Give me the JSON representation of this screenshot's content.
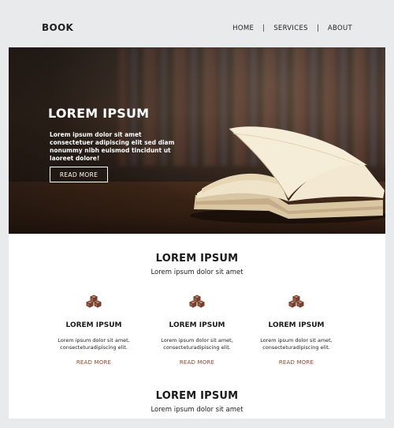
{
  "header": {
    "logo": "BOOK",
    "nav": [
      "HOME",
      "SERVICES",
      "ABOUT"
    ],
    "separator": "|"
  },
  "hero": {
    "title": "LOREM IPSUM",
    "text": "Lorem ipsum dolor sit amet consectetuer adipiscing elit sed diam nonummy nibh euismod tincidunt ut laoreet dolore!",
    "button": "READ MORE"
  },
  "section1": {
    "title": "LOREM IPSUM",
    "subtitle": "Lorem ipsum dolor sit amet"
  },
  "features": [
    {
      "icon": "boxes-icon",
      "title": "LOREM IPSUM",
      "text": "Lorem ipsum dolor sit amet, consecteturadipiscing elit.",
      "link": "READ MORE"
    },
    {
      "icon": "boxes-icon",
      "title": "LOREM IPSUM",
      "text": "Lorem ipsum dolor sit amet, consecteturadipiscing elit.",
      "link": "READ MORE"
    },
    {
      "icon": "boxes-icon",
      "title": "LOREM IPSUM",
      "text": "Lorem ipsum dolor sit amet, consecteturadipiscing elit.",
      "link": "READ MORE"
    }
  ],
  "section2": {
    "title": "LOREM IPSUM",
    "subtitle": "Lorem ipsum dolor sit amet"
  },
  "colors": {
    "accent": "#8a4a34",
    "background": "#e9eaec"
  }
}
